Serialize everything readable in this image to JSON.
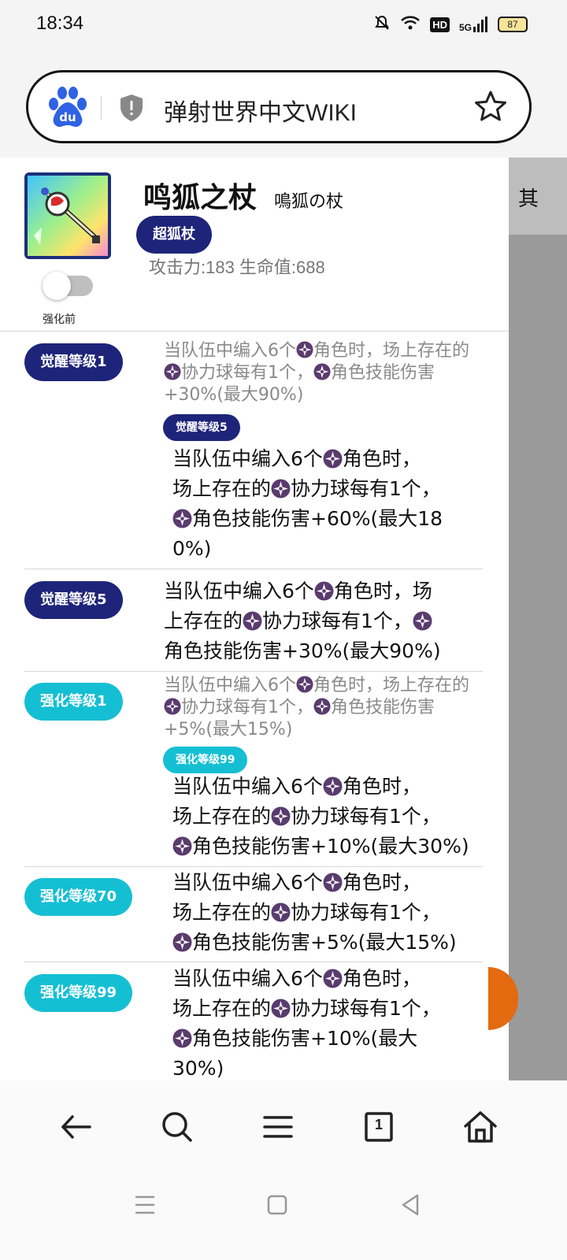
{
  "status_bar": {
    "time": "18:34",
    "hd": "HD",
    "signal": "5G",
    "battery": "87"
  },
  "url_bar": {
    "title": "弹射世界中文WIKI"
  },
  "side_tab": {
    "label": "其"
  },
  "item": {
    "name": "鸣狐之杖",
    "jp_name": "鳴狐の杖",
    "type": "超狐杖",
    "stats": "攻击力:183 生命值:688",
    "toggle_label": "强化前"
  },
  "abilities": [
    {
      "badge": "觉醒等级1",
      "gray": [
        "当队伍中编入6个",
        "角色时，场上存",
        "在的",
        "协力球每有1个，",
        "角色技能",
        "伤害+30%(最大90%)"
      ],
      "sub_badge": "觉醒等级5",
      "dark": [
        "当队伍中编入6个",
        "角色时，",
        "场上存在的",
        "协力球每有1个，",
        "角色技能伤害+60%(最大18",
        "0%)"
      ]
    },
    {
      "badge": "觉醒等级5",
      "dark": [
        "当队伍中编入6个",
        "角色时，场",
        "上存在的",
        "协力球每有1个，",
        "角色技能伤害+30%(最大90%)"
      ]
    },
    {
      "badge": "强化等级1",
      "gray": [
        "当队伍中编入6个",
        "角色时，场上存",
        "在的",
        "协力球每有1个，",
        "角色技能",
        "伤害+5%(最大15%)"
      ],
      "sub_badge": "强化等级99",
      "dark": [
        "当队伍中编入6个",
        "角色时，",
        "场上存在的",
        "协力球每有1个，",
        "角色技能伤害+10%(最大30%)"
      ]
    },
    {
      "badge": "强化等级70",
      "dark": [
        "当队伍中编入6个",
        "角色时，",
        "场上存在的",
        "协力球每有1个，",
        "角色技能伤害+5%(最大15%)"
      ]
    },
    {
      "badge": "强化等级99",
      "dark": [
        "当队伍中编入6个",
        "角色时，",
        "场上存在的",
        "协力球每有1个，",
        "角色技能伤害+10%(最大",
        "30%)"
      ]
    }
  ],
  "bottom_nav": {
    "tab_count": "1"
  },
  "icons": [
    "baidu-paw-icon",
    "shield-icon",
    "star-icon",
    "back-arrow-icon",
    "search-icon",
    "menu-icon",
    "tabs-icon",
    "home-icon",
    "element-icon"
  ]
}
